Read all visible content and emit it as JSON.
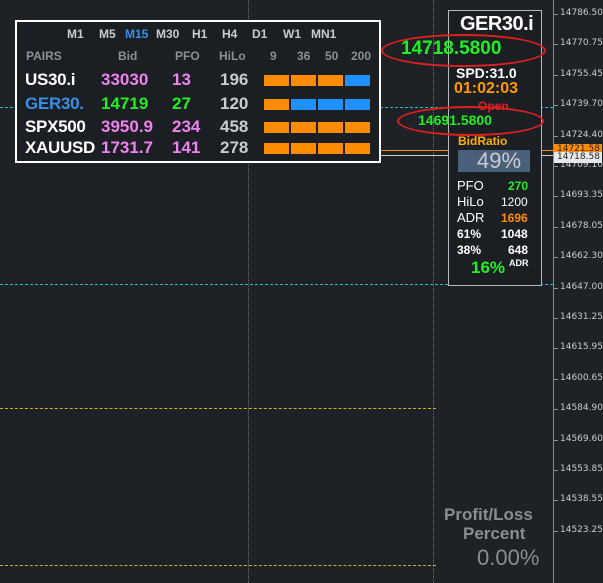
{
  "timeframes": [
    {
      "label": "M1",
      "active": false
    },
    {
      "label": "M5",
      "active": false
    },
    {
      "label": "M15",
      "active": true
    },
    {
      "label": "M30",
      "active": false
    },
    {
      "label": "H1",
      "active": false
    },
    {
      "label": "H4",
      "active": false
    },
    {
      "label": "D1",
      "active": false
    },
    {
      "label": "W1",
      "active": false
    },
    {
      "label": "MN1",
      "active": false
    }
  ],
  "columns": {
    "pairs": "PAIRS",
    "bid": "Bid",
    "pfo": "PFO",
    "hilo": "HiLo",
    "p9": "9",
    "p36": "36",
    "p50": "50",
    "p200": "200"
  },
  "rows": [
    {
      "symbol": "US30.i",
      "bid": "33030",
      "pfo": "13",
      "hilo": "196",
      "symbol_color": "#ffffff",
      "bid_color": "#ee82ee",
      "pfo_color": "#ee82ee",
      "bars": [
        "#ff8c00",
        "#ff8c00",
        "#ff8c00",
        "#1e90ff"
      ]
    },
    {
      "symbol": "GER30.",
      "bid": "14719",
      "pfo": "27",
      "hilo": "120",
      "symbol_color": "#3a8fe8",
      "bid_color": "#22ee22",
      "pfo_color": "#22ee22",
      "bars": [
        "#ff8c00",
        "#1e90ff",
        "#1e90ff",
        "#1e90ff"
      ]
    },
    {
      "symbol": "SPX500",
      "bid": "3950.9",
      "pfo": "234",
      "hilo": "458",
      "symbol_color": "#ffffff",
      "bid_color": "#ee82ee",
      "pfo_color": "#ee82ee",
      "bars": [
        "#ff8c00",
        "#ff8c00",
        "#ff8c00",
        "#ff8c00"
      ]
    },
    {
      "symbol": "XAUUSD",
      "bid": "1731.7",
      "pfo": "141",
      "hilo": "278",
      "symbol_color": "#ffffff",
      "bid_color": "#ee82ee",
      "pfo_color": "#ee82ee",
      "bars": [
        "#ff8c00",
        "#ff8c00",
        "#ff8c00",
        "#ff8c00"
      ]
    }
  ],
  "info": {
    "symbol": "GER30.i",
    "bid_price": "14718.5800",
    "spread": "SPD:31.0",
    "countdown": "01:02:03",
    "open_label": "Open",
    "open_price": "14691.5800",
    "bidratio_label": "BidRatio",
    "bidratio_value": "49%",
    "pfo_label": "PFO",
    "pfo_value": "270",
    "hilo_label": "HiLo",
    "hilo_value": "1200",
    "adr_label": "ADR",
    "adr_value": "1696",
    "pct61_label": "61%",
    "pct61_value": "1048",
    "pct38_label": "38%",
    "pct38_value": "648",
    "adr_pct": "16%",
    "adr_sup": "ADR"
  },
  "profit_loss": {
    "line1": "Profit/Loss",
    "line2": "Percent",
    "value": "0.00%"
  },
  "price_axis": [
    "14786.50",
    "14770.75",
    "14755.45",
    "14739.70",
    "14724.40",
    "14709.10",
    "14693.35",
    "14678.05",
    "14662.30",
    "14647.00",
    "14631.25",
    "14615.95",
    "14600.65",
    "14584.90",
    "14569.60",
    "14553.85",
    "14538.55",
    "14523.25"
  ],
  "price_tags": {
    "orange": "14721.58",
    "white": "14718.58"
  },
  "colors": {
    "background": "#1e2227",
    "orange_bar": "#ff8c00",
    "blue_bar": "#1e90ff",
    "highlight_ellipse": "#e01f1f",
    "cyan_line": "#20c0c8",
    "yellow_line": "#d4b020"
  }
}
